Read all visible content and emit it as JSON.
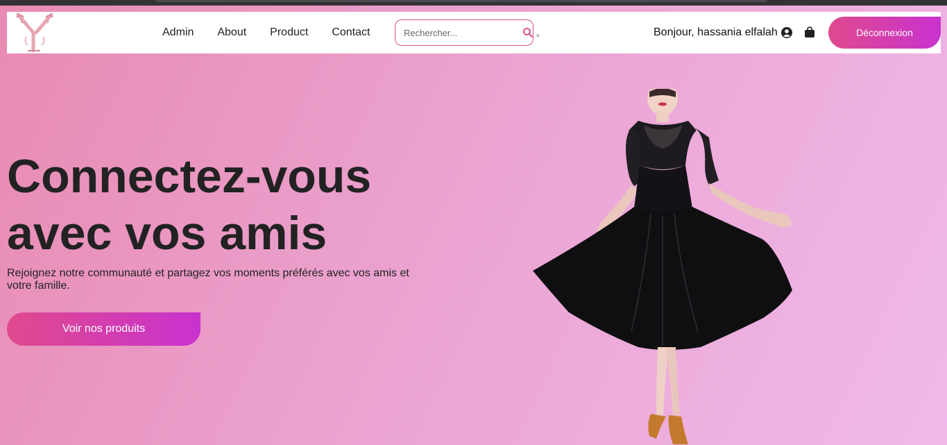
{
  "nav": {
    "links": [
      {
        "label": "Admin"
      },
      {
        "label": "About"
      },
      {
        "label": "Product"
      },
      {
        "label": "Contact"
      }
    ],
    "search": {
      "placeholder": "Rechercher..."
    },
    "separator": "。",
    "greeting": "Bonjour, hassania elfalah",
    "logout_label": "Déconnexion"
  },
  "hero": {
    "title": "Connectez-vous avec vos amis",
    "subtitle": "Rejoignez notre communauté et partagez vos moments préférés avec vos amis et votre famille.",
    "cta_label": "Voir nos produits"
  },
  "icons": {
    "search": "search-icon",
    "user": "user-circle-icon",
    "bag": "shopping-bag-icon",
    "logo": "y-monogram-logo"
  },
  "colors": {
    "accent_start": "#df4a8d",
    "accent_end": "#c832cf",
    "bg_start": "#e88ab2",
    "bg_end": "#efb9ea"
  }
}
